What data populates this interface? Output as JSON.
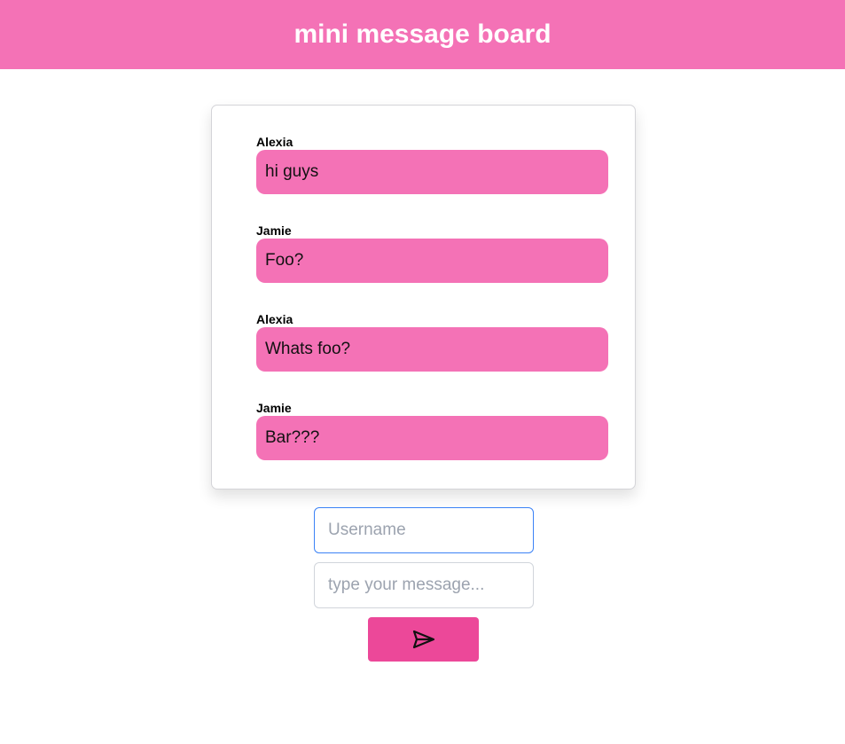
{
  "app": {
    "title": "mini message board",
    "accent_color": "#f472b6",
    "button_color": "#ec4899"
  },
  "messages": [
    {
      "author": "Alexia",
      "text": "hi guys"
    },
    {
      "author": "Jamie",
      "text": "Foo?"
    },
    {
      "author": "Alexia",
      "text": "Whats foo?"
    },
    {
      "author": "Jamie",
      "text": "Bar???"
    }
  ],
  "form": {
    "username": {
      "value": "",
      "placeholder": "Username"
    },
    "message": {
      "value": "",
      "placeholder": "type your message..."
    },
    "send_icon": "send-icon"
  }
}
